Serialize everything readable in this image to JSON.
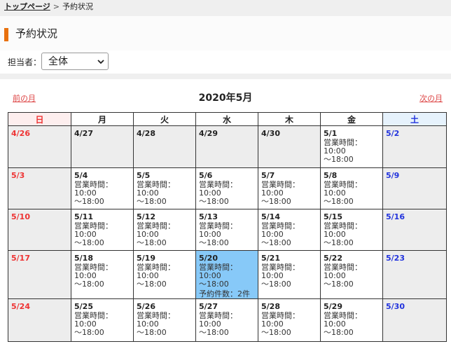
{
  "breadcrumb": {
    "home": "トップページ",
    "sep": ">",
    "current": "予約状況"
  },
  "page_title": "予約状況",
  "filter": {
    "label": "担当者：",
    "selected": "全体"
  },
  "calendar": {
    "prev_label": "前の月",
    "next_label": "次の月",
    "month_title": "2020年5月",
    "weekdays": [
      "日",
      "月",
      "火",
      "水",
      "木",
      "金",
      "土"
    ],
    "hours_line1": "営業時間：10:00",
    "hours_line2": "～18:00",
    "booking_label": "予約件数：2件",
    "weeks": [
      [
        "4/26",
        "4/27",
        "4/28",
        "4/29",
        "4/30",
        "5/1",
        "5/2"
      ],
      [
        "5/3",
        "5/4",
        "5/5",
        "5/6",
        "5/7",
        "5/8",
        "5/9"
      ],
      [
        "5/10",
        "5/11",
        "5/12",
        "5/13",
        "5/14",
        "5/15",
        "5/16"
      ],
      [
        "5/17",
        "5/18",
        "5/19",
        "5/20",
        "5/21",
        "5/22",
        "5/23"
      ],
      [
        "5/24",
        "5/25",
        "5/26",
        "5/27",
        "5/28",
        "5/29",
        "5/30"
      ]
    ]
  },
  "colors": {
    "accent": "#e8710f",
    "highlight": "#87c9f8",
    "sunday": "#e33333",
    "saturday": "#2233dd"
  }
}
